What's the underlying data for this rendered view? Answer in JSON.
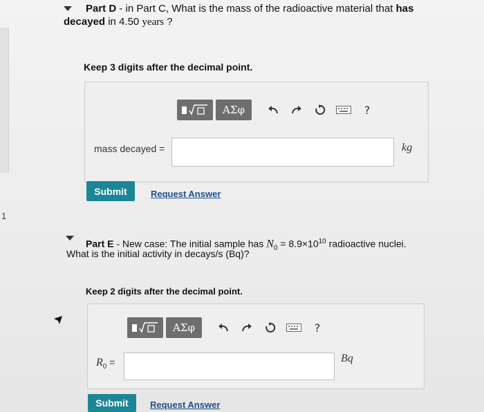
{
  "partD": {
    "title_prefix": "Part D",
    "title_rest": " - in Part C, What is the mass of the radioactive material that ",
    "title_bold": "has",
    "line2_bold": "decayed",
    "line2_mid": " in 4.50 ",
    "line2_serif": "years",
    "line2_end": " ?",
    "instruction": "Keep 3 digits after the decimal point.",
    "toolbar": {
      "greek": "ΑΣφ",
      "help": "?"
    },
    "field_label": "mass decayed =",
    "unit": "kg",
    "submit": "Submit",
    "request": "Request Answer"
  },
  "partE": {
    "title_prefix": "Part E",
    "title_rest": " - New case: The initial sample has ",
    "math_sym": "N",
    "math_sub": "0",
    "math_rest": " = 8.9×10",
    "math_sup": "10",
    "title_end": " radioactive nuclei.",
    "line2": "What is the initial activity in decays/s (Bq)?",
    "instruction": "Keep 2 digits after the decimal point.",
    "toolbar": {
      "greek": "ΑΣφ",
      "help": "?"
    },
    "field_sym": "R",
    "field_sub": "0",
    "field_eq": " =",
    "unit": "Bq",
    "submit": "Submit",
    "request": "Request Answer"
  },
  "sidebar": {
    "number": "1"
  },
  "colors": {
    "submit": "#1d8696",
    "toolbar_btn": "#6e6e6e",
    "link": "#1e4d8c"
  }
}
